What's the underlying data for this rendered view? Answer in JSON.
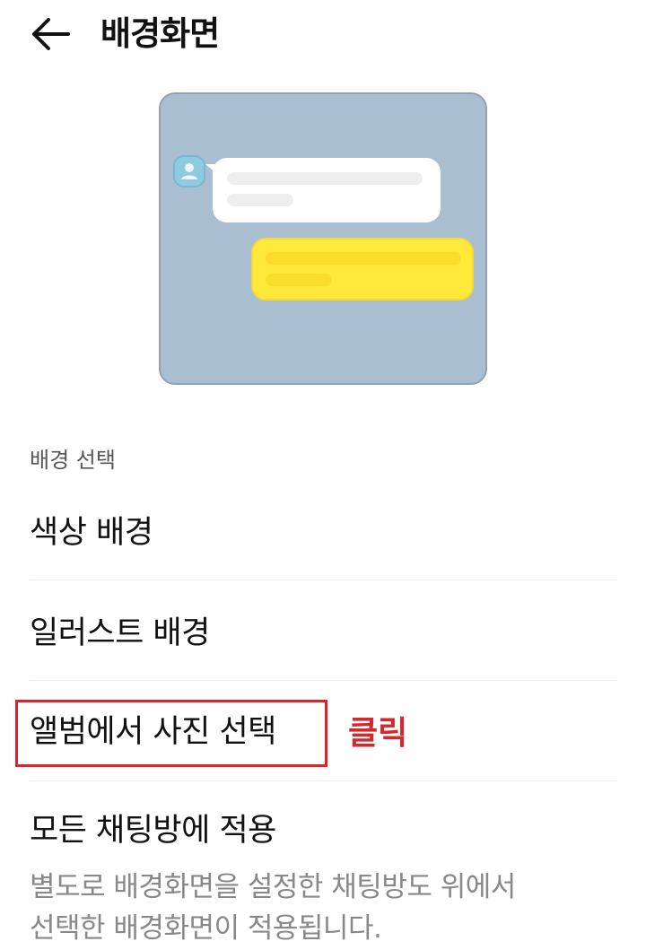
{
  "header": {
    "back_icon": "arrow-left-icon",
    "title": "배경화면"
  },
  "preview": {
    "background_color": "#a9bfd1",
    "incoming_bubble_color": "#ffffff",
    "outgoing_bubble_color": "#ffe93b",
    "avatar_icon": "person-icon"
  },
  "section": {
    "label": "배경 선택"
  },
  "options": {
    "color_background": "색상 배경",
    "illustration_background": "일러스트 배경",
    "album_photo": "앨범에서 사진 선택",
    "apply_all": "모든 채팅방에 적용"
  },
  "annotation": {
    "click_label": "클릭",
    "color": "#d4282d"
  },
  "description": {
    "line1": "별도로 배경화면을 설정한 채팅방도 위에서",
    "line2": "선택한 배경화면이 적용됩니다."
  }
}
